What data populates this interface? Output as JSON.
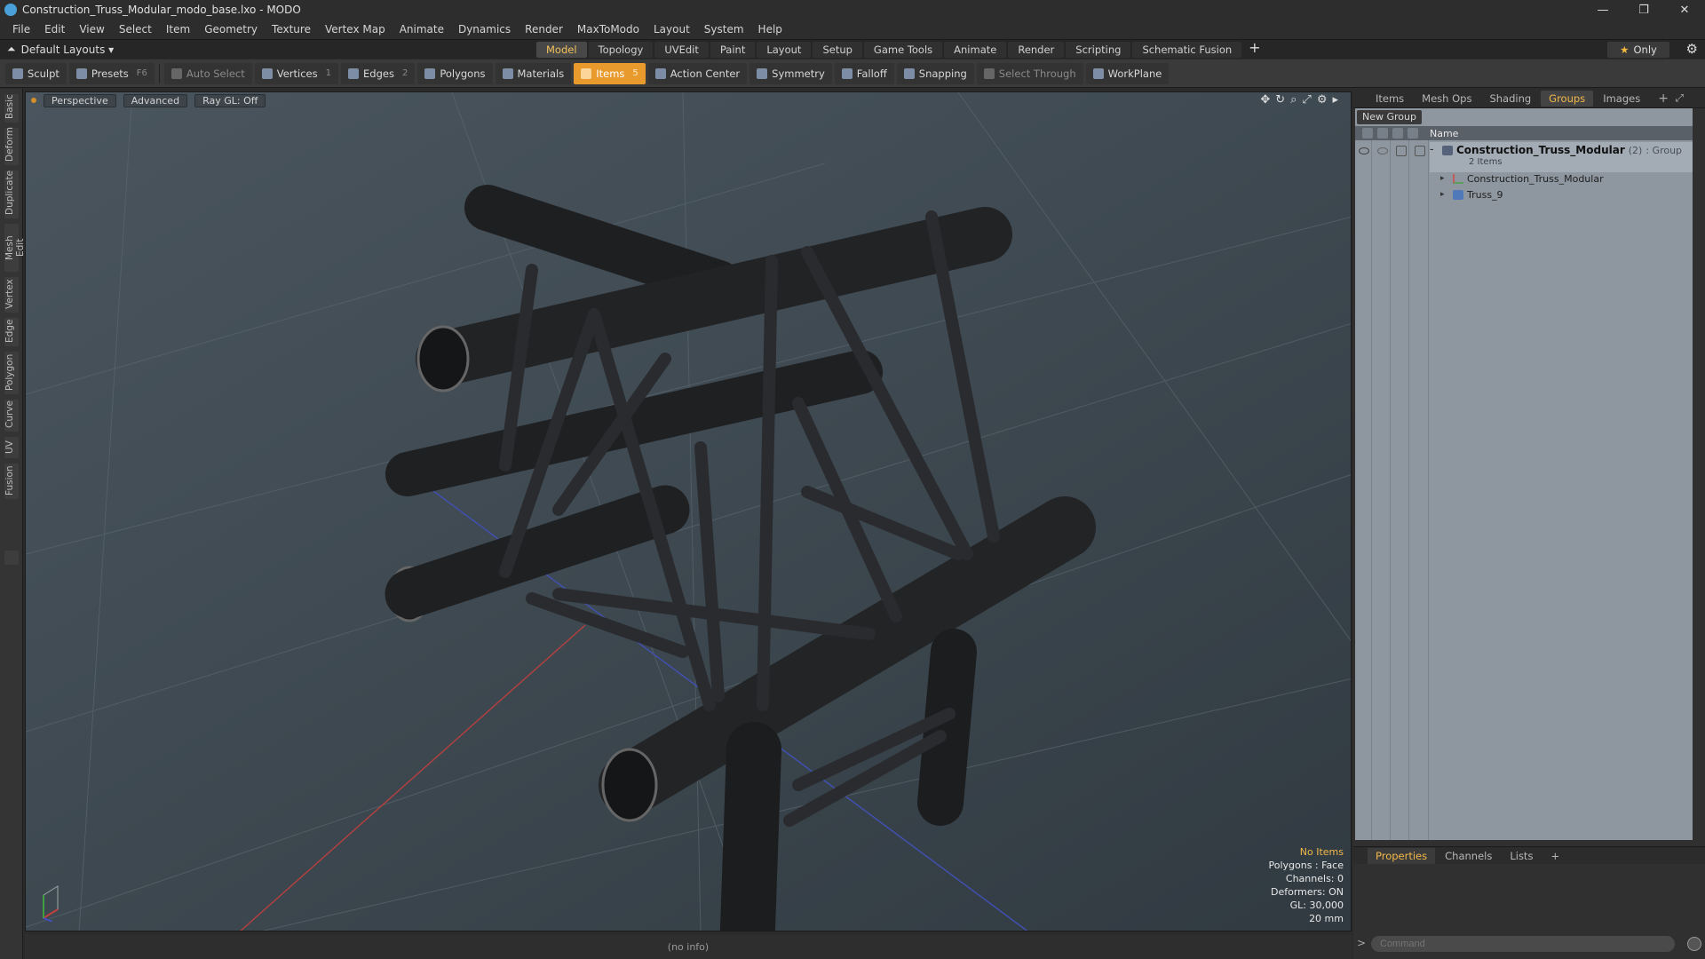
{
  "window": {
    "title": "Construction_Truss_Modular_modo_base.lxo - MODO",
    "controls": [
      "—",
      "❐",
      "✕"
    ]
  },
  "menu": [
    "File",
    "Edit",
    "View",
    "Select",
    "Item",
    "Geometry",
    "Texture",
    "Vertex Map",
    "Animate",
    "Dynamics",
    "Render",
    "MaxToModo",
    "Layout",
    "System",
    "Help"
  ],
  "layout": {
    "selector": "Default Layouts ▾",
    "tabs": [
      "Model",
      "Topology",
      "UVEdit",
      "Paint",
      "Layout",
      "Setup",
      "Game Tools",
      "Animate",
      "Render",
      "Scripting",
      "Schematic Fusion"
    ],
    "active_tab": "Model",
    "add_tab": "+",
    "only_label": "Only"
  },
  "toolbar": {
    "sculpt": "Sculpt",
    "presets": "Presets",
    "presets_key": "F6",
    "auto_select": "Auto Select",
    "vertices": "Vertices",
    "vertices_key": "1",
    "edges": "Edges",
    "edges_key": "2",
    "polygons": "Polygons",
    "materials": "Materials",
    "items": "Items",
    "items_key": "5",
    "action_center": "Action Center",
    "symmetry": "Symmetry",
    "falloff": "Falloff",
    "snapping": "Snapping",
    "select_through": "Select Through",
    "workplane": "WorkPlane"
  },
  "left_tabs": [
    "Basic",
    "Deform",
    "Duplicate",
    "Mesh Edit",
    "Vertex",
    "Edge",
    "Polygon",
    "Curve",
    "UV",
    "Fusion"
  ],
  "viewport": {
    "view": "Perspective",
    "shading": "Advanced",
    "raygl": "Ray GL: Off",
    "stats": {
      "selection": "No Items",
      "polygons": "Polygons : Face",
      "channels": "Channels: 0",
      "deformers": "Deformers: ON",
      "gl": "GL: 30,000",
      "scale": "20 mm"
    }
  },
  "status": "(no info)",
  "right_panel": {
    "tabs": [
      "Items",
      "Mesh Ops",
      "Shading",
      "Groups",
      "Images"
    ],
    "active_tab": "Groups",
    "new_group": "New Group",
    "column_name": "Name",
    "group": {
      "name": "Construction_Truss_Modular",
      "count": "(2)",
      "type": ": Group",
      "items_label": "2 Items",
      "children": [
        "Construction_Truss_Modular",
        "Truss_9"
      ]
    },
    "bottom_tabs": [
      "Properties",
      "Channels",
      "Lists"
    ],
    "bottom_active": "Properties",
    "command_placeholder": "Command",
    "command_prompt": ">"
  },
  "colors": {
    "accent": "#e89a2c",
    "viewport_bg": "#3f4a52",
    "panel_bg": "#8e969f"
  }
}
